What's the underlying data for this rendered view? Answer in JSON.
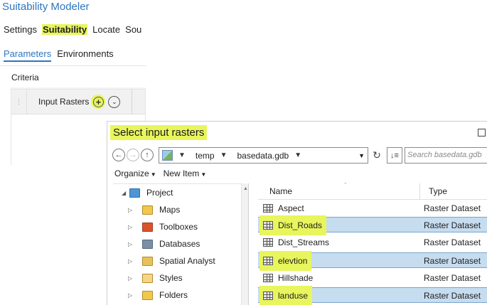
{
  "modeler": {
    "title": "Suitability Modeler",
    "tabs": [
      {
        "label": "Settings",
        "active": false
      },
      {
        "label": "Suitability",
        "active": true
      },
      {
        "label": "Locate",
        "active": false
      },
      {
        "label": "Sou",
        "active": false
      }
    ],
    "subtabs": [
      {
        "label": "Parameters",
        "active": true
      },
      {
        "label": "Environments",
        "active": false
      }
    ],
    "criteria_label": "Criteria",
    "table_header": "Input Rasters",
    "add_icon": "plus-circle-icon",
    "dropdown_icon": "chevron-down-circle-icon"
  },
  "dialog": {
    "title": "Select input rasters",
    "path": {
      "segments": [
        "temp",
        "basedata.gdb"
      ]
    },
    "search_placeholder": "Search basedata.gdb",
    "toolbar": {
      "organize": "Organize",
      "new_item": "New Item"
    },
    "tree": [
      {
        "label": "Project",
        "icon": "project-icon",
        "expanded": true
      },
      {
        "label": "Maps",
        "icon": "maps-folder-icon"
      },
      {
        "label": "Toolboxes",
        "icon": "toolbox-icon"
      },
      {
        "label": "Databases",
        "icon": "database-icon"
      },
      {
        "label": "Spatial Analyst",
        "icon": "spatial-analyst-icon"
      },
      {
        "label": "Styles",
        "icon": "styles-icon"
      },
      {
        "label": "Folders",
        "icon": "folder-icon"
      }
    ],
    "columns": {
      "name": "Name",
      "type": "Type"
    },
    "rows": [
      {
        "name": "Aspect",
        "type": "Raster Dataset",
        "selected": false
      },
      {
        "name": "Dist_Roads",
        "type": "Raster Dataset",
        "selected": true
      },
      {
        "name": "Dist_Streams",
        "type": "Raster Dataset",
        "selected": false
      },
      {
        "name": "elevtion",
        "type": "Raster Dataset",
        "selected": true
      },
      {
        "name": "Hillshade",
        "type": "Raster Dataset",
        "selected": false
      },
      {
        "name": "landuse",
        "type": "Raster Dataset",
        "selected": true
      }
    ],
    "highlight_color": "#e8f55c",
    "selection_color": "#c6dcef"
  }
}
